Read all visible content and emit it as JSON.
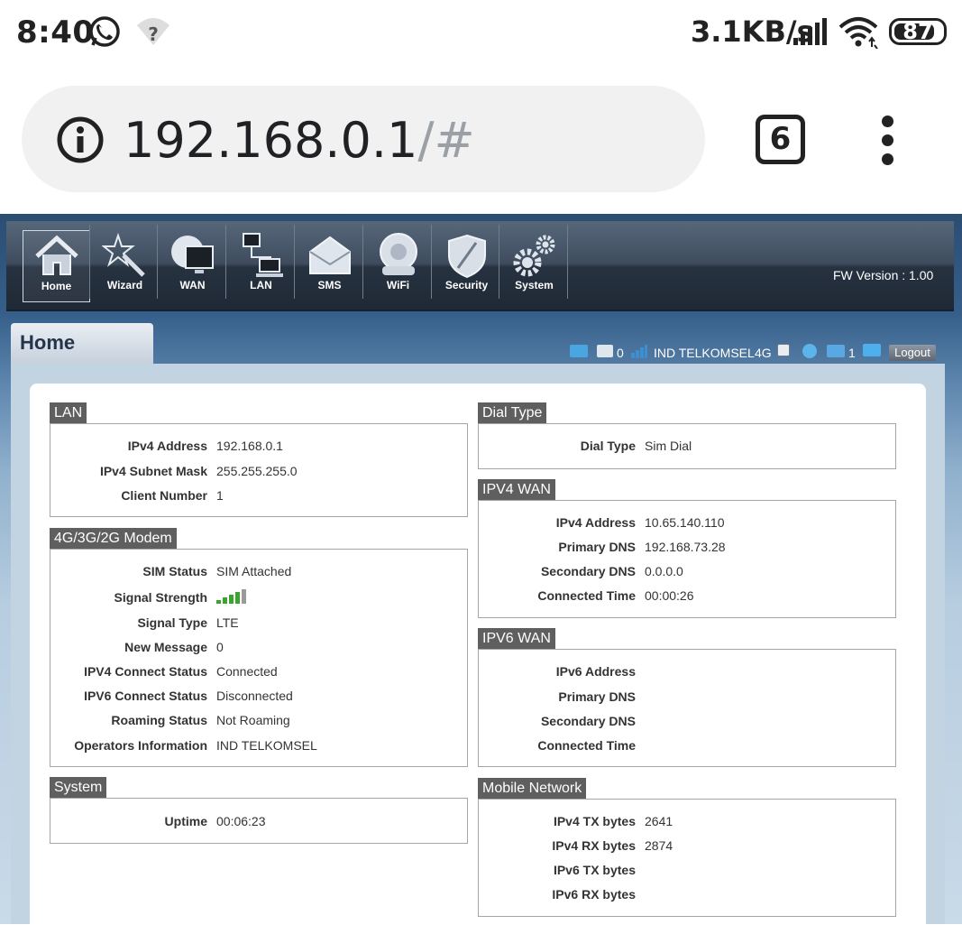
{
  "status_bar": {
    "time": "8:40",
    "speed": "3.1KB/s",
    "battery": "87",
    "battery_percent": 87
  },
  "browser": {
    "url_host": "192.168.0.1",
    "url_path": "/#",
    "tab_count": "6"
  },
  "nav": {
    "items": [
      {
        "label": "Home",
        "icon": "home-icon"
      },
      {
        "label": "Wizard",
        "icon": "wizard-icon"
      },
      {
        "label": "WAN",
        "icon": "wan-icon"
      },
      {
        "label": "LAN",
        "icon": "lan-icon"
      },
      {
        "label": "SMS",
        "icon": "sms-icon"
      },
      {
        "label": "WiFi",
        "icon": "wifi-icon"
      },
      {
        "label": "Security",
        "icon": "security-icon"
      },
      {
        "label": "System",
        "icon": "system-icon"
      }
    ],
    "fw_version": "FW Version : 1.00"
  },
  "page_tab": "Home",
  "status_strip": {
    "sms_count": "0",
    "operator": "IND TELKOMSEL",
    "network_type": "4G",
    "clients": "1",
    "logout": "Logout"
  },
  "lan": {
    "title": "LAN",
    "rows": [
      {
        "k": "IPv4 Address",
        "v": "192.168.0.1"
      },
      {
        "k": "IPv4 Subnet Mask",
        "v": "255.255.255.0"
      },
      {
        "k": "Client Number",
        "v": "1"
      }
    ]
  },
  "modem": {
    "title": "4G/3G/2G Modem",
    "rows": [
      {
        "k": "SIM Status",
        "v": "SIM Attached"
      },
      {
        "k": "Signal Strength",
        "v": ""
      },
      {
        "k": "Signal Type",
        "v": "LTE"
      },
      {
        "k": "New Message",
        "v": "0"
      },
      {
        "k": "IPV4 Connect Status",
        "v": "Connected"
      },
      {
        "k": "IPV6 Connect Status",
        "v": "Disconnected"
      },
      {
        "k": "Roaming Status",
        "v": "Not Roaming"
      },
      {
        "k": "Operators Information",
        "v": "IND TELKOMSEL"
      }
    ],
    "signal_level": 4,
    "signal_max": 5
  },
  "system": {
    "title": "System",
    "rows": [
      {
        "k": "Uptime",
        "v": "00:06:23"
      }
    ]
  },
  "dial": {
    "title": "Dial Type",
    "rows": [
      {
        "k": "Dial Type",
        "v": "Sim Dial"
      }
    ]
  },
  "ipv4wan": {
    "title": "IPV4 WAN",
    "rows": [
      {
        "k": "IPv4 Address",
        "v": "10.65.140.110"
      },
      {
        "k": "Primary DNS",
        "v": "192.168.73.28"
      },
      {
        "k": "Secondary DNS",
        "v": "0.0.0.0"
      },
      {
        "k": "Connected Time",
        "v": "00:00:26"
      }
    ]
  },
  "ipv6wan": {
    "title": "IPV6 WAN",
    "rows": [
      {
        "k": "IPv6 Address",
        "v": ""
      },
      {
        "k": "Primary DNS",
        "v": ""
      },
      {
        "k": "Secondary DNS",
        "v": ""
      },
      {
        "k": "Connected Time",
        "v": ""
      }
    ]
  },
  "mobile": {
    "title": "Mobile Network",
    "rows": [
      {
        "k": "IPv4 TX bytes",
        "v": "2641"
      },
      {
        "k": "IPv4 RX bytes",
        "v": "2874"
      },
      {
        "k": "IPv6 TX bytes",
        "v": ""
      },
      {
        "k": "IPv6 RX bytes",
        "v": ""
      }
    ]
  },
  "colors": {
    "section_title_bg": "#5f5f5f",
    "signal_green": "#3aa52b"
  }
}
